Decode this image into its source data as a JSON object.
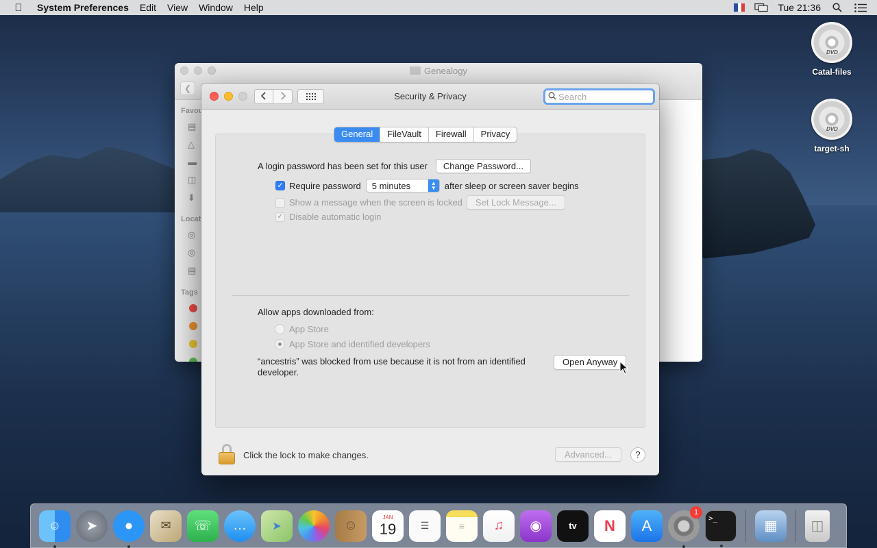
{
  "menubar": {
    "app_name": "System Preferences",
    "menus": [
      "Edit",
      "View",
      "Window",
      "Help"
    ],
    "clock": "Tue 21:36",
    "icons": [
      "apple-icon",
      "input-flag-icon",
      "display-mirror-icon",
      "spotlight-icon",
      "notification-center-icon"
    ]
  },
  "desktop": {
    "icons": [
      {
        "label": "Catal-files",
        "icon": "dvd-disc-icon"
      },
      {
        "label": "target-sh",
        "icon": "dvd-disc-icon"
      }
    ]
  },
  "finder": {
    "title": "Genealogy",
    "sidebar_labels": {
      "favourites": "Favou",
      "locations": "Locat",
      "tags": "Tags"
    },
    "tag_colors": [
      "#e94b45",
      "#e8902f",
      "#e8c42f",
      "#5cc152"
    ]
  },
  "prefs": {
    "title": "Security & Privacy",
    "search": {
      "placeholder": "Search",
      "value": ""
    },
    "tabs": [
      {
        "label": "General",
        "active": true
      },
      {
        "label": "FileVault",
        "active": false
      },
      {
        "label": "Firewall",
        "active": false
      },
      {
        "label": "Privacy",
        "active": false
      }
    ],
    "general": {
      "login_text": "A login password has been set for this user",
      "change_password_btn": "Change Password...",
      "require_password_label": "Require password",
      "require_password_checked": true,
      "require_password_delay": "5 minutes",
      "after_sleep_text": "after sleep or screen saver begins",
      "show_message_label": "Show a message when the screen is locked",
      "show_message_checked": false,
      "set_lock_message_btn": "Set Lock Message...",
      "disable_auto_login_label": "Disable automatic login",
      "disable_auto_login_checked": true,
      "allow_apps_label": "Allow apps downloaded from:",
      "radio_app_store": "App Store",
      "radio_identified": "App Store and identified developers",
      "radio_selected": "App Store and identified developers",
      "blocked_message": "“ancestris” was blocked from use because it is not from an identified developer.",
      "open_anyway_btn": "Open Anyway"
    },
    "footer": {
      "lock_text": "Click the lock to make changes.",
      "advanced_btn": "Advanced...",
      "help_btn": "?"
    }
  },
  "dock": {
    "items": [
      {
        "name": "finder-icon",
        "color": "#3ea2f2",
        "running": true
      },
      {
        "name": "launchpad-icon",
        "color": "#8a8f98",
        "running": false
      },
      {
        "name": "safari-icon",
        "color": "#1e8cf0",
        "running": true
      },
      {
        "name": "mail-icon",
        "color": "#d9c9a2",
        "running": false
      },
      {
        "name": "facetime-icon",
        "color": "#36c759",
        "running": false
      },
      {
        "name": "messages-icon",
        "color": "#3aa6f5",
        "running": false
      },
      {
        "name": "maps-icon",
        "color": "#8bc46a",
        "running": false
      },
      {
        "name": "photos-icon",
        "color": "#f4f4f4",
        "running": false
      },
      {
        "name": "contacts-icon",
        "color": "#b08652",
        "running": false
      },
      {
        "name": "calendar-icon",
        "color": "#ffffff",
        "running": false,
        "month": "JAN",
        "day": "19"
      },
      {
        "name": "reminders-icon",
        "color": "#f8f8f8",
        "running": false
      },
      {
        "name": "notes-icon",
        "color": "#f7dd59",
        "running": false
      },
      {
        "name": "music-icon",
        "color": "#f64e5f",
        "running": false
      },
      {
        "name": "podcasts-icon",
        "color": "#9c45d6",
        "running": false
      },
      {
        "name": "tv-icon",
        "color": "#111111",
        "running": false
      },
      {
        "name": "news-icon",
        "color": "#f7f7f7",
        "running": false
      },
      {
        "name": "app-store-icon",
        "color": "#2a8cf3",
        "running": false
      },
      {
        "name": "system-preferences-icon",
        "color": "#8c8c8c",
        "running": true,
        "badge": "1"
      },
      {
        "name": "terminal-icon",
        "color": "#1a1a1a",
        "running": true
      }
    ],
    "extras": [
      {
        "name": "preview-icon",
        "color": "#7aa8d8"
      },
      {
        "name": "trash-icon",
        "color": "#dcdcdc"
      }
    ]
  }
}
